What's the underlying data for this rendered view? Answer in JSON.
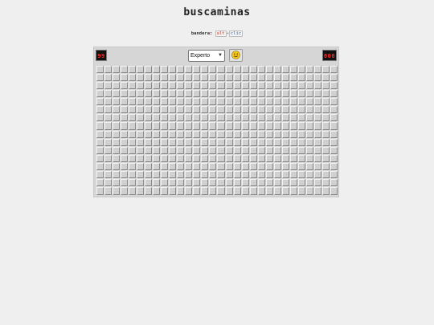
{
  "title": "buscaminas",
  "hint": {
    "label": "bandera:",
    "key1": "alt",
    "plus": "+",
    "key2": "clic"
  },
  "mine_counter": "99",
  "timer": "000",
  "difficulty": {
    "selected": "Experto"
  },
  "face": {
    "icon": "smiley-face-icon",
    "fill": "#f5c518"
  },
  "board": {
    "rows": 16,
    "cols": 30,
    "state": "all-covered"
  },
  "colors": {
    "lcd_digits": "#ff2a2a",
    "lcd_bg": "#111111",
    "cell": "#d0d0d0",
    "background": "#efefef"
  }
}
